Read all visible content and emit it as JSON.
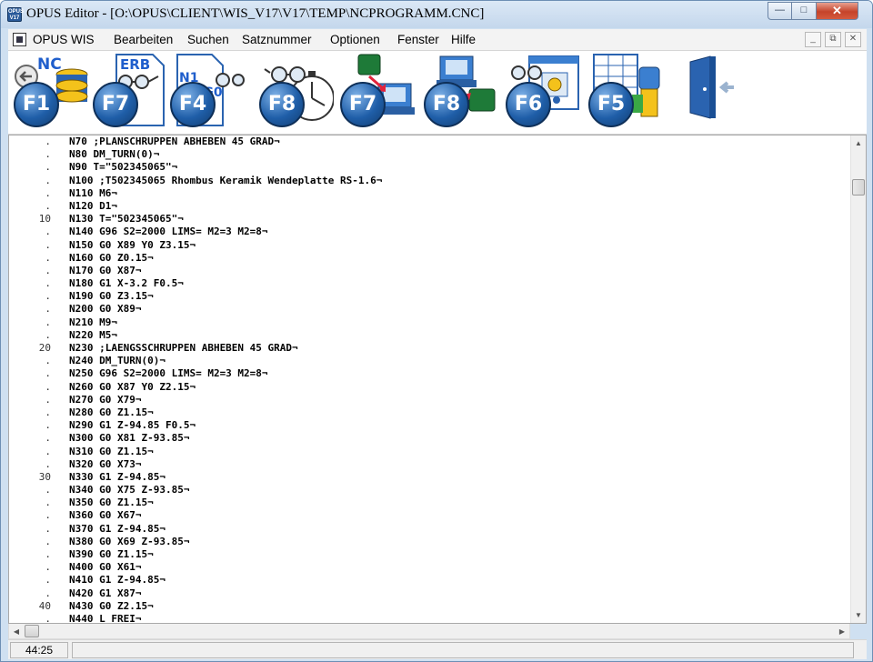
{
  "window": {
    "title": "OPUS Editor - [O:\\OPUS\\CLIENT\\WIS_V17\\V17\\TEMP\\NCPROGRAMM.CNC]",
    "app_icon_text": "OPUS V17"
  },
  "menu": {
    "items": [
      "OPUS WIS",
      "Bearbeiten",
      "Suchen",
      "Satznummer",
      "Optionen",
      "Fenster",
      "Hilfe"
    ]
  },
  "toolbar": {
    "buttons": [
      {
        "key": "F1",
        "caption": "NC",
        "icon": "nc-database-back-icon"
      },
      {
        "key": "F7",
        "caption": "ERB",
        "icon": "erb-document-glasses-icon"
      },
      {
        "key": "F4",
        "caption": "N1 N2 G0",
        "icon": "nc-blocks-document-icon"
      },
      {
        "key": "F8",
        "caption": "",
        "icon": "glasses-stopwatch-icon"
      },
      {
        "key": "F7",
        "caption": "",
        "icon": "transfer-machine-to-pc-icon"
      },
      {
        "key": "F8",
        "caption": "",
        "icon": "transfer-pc-to-machine-icon"
      },
      {
        "key": "F6",
        "caption": "",
        "icon": "glasses-settings-window-icon"
      },
      {
        "key": "F5",
        "caption": "",
        "icon": "table-tool-icon"
      },
      {
        "key": "",
        "caption": "",
        "icon": "exit-door-icon"
      }
    ]
  },
  "editor": {
    "line_numbers": [
      ".",
      ".",
      ".",
      ".",
      ".",
      ".",
      "10",
      ".",
      ".",
      ".",
      ".",
      ".",
      ".",
      ".",
      ".",
      ".",
      "20",
      ".",
      ".",
      ".",
      ".",
      ".",
      ".",
      ".",
      ".",
      ".",
      "30",
      ".",
      ".",
      ".",
      ".",
      ".",
      ".",
      ".",
      ".",
      ".",
      "40",
      "."
    ],
    "lines": [
      "N70 ;PLANSCHRUPPEN ABHEBEN 45 GRAD¬",
      "N80 DM_TURN(0)¬",
      "N90 T=\"502345065\"¬",
      "N100 ;T502345065 Rhombus Keramik Wendeplatte RS-1.6¬",
      "N110 M6¬",
      "N120 D1¬",
      "N130 T=\"502345065\"¬",
      "N140 G96 S2=2000 LIMS= M2=3 M2=8¬",
      "N150 G0 X89 Y0 Z3.15¬",
      "N160 G0 Z0.15¬",
      "N170 G0 X87¬",
      "N180 G1 X-3.2 F0.5¬",
      "N190 G0 Z3.15¬",
      "N200 G0 X89¬",
      "N210 M9¬",
      "N220 M5¬",
      "N230 ;LAENGSSCHRUPPEN ABHEBEN 45 GRAD¬",
      "N240 DM_TURN(0)¬",
      "N250 G96 S2=2000 LIMS= M2=3 M2=8¬",
      "N260 G0 X87 Y0 Z2.15¬",
      "N270 G0 X79¬",
      "N280 G0 Z1.15¬",
      "N290 G1 Z-94.85 F0.5¬",
      "N300 G0 X81 Z-93.85¬",
      "N310 G0 Z1.15¬",
      "N320 G0 X73¬",
      "N330 G1 Z-94.85¬",
      "N340 G0 X75 Z-93.85¬",
      "N350 G0 Z1.15¬",
      "N360 G0 X67¬",
      "N370 G1 Z-94.85¬",
      "N380 G0 X69 Z-93.85¬",
      "N390 G0 Z1.15¬",
      "N400 G0 X61¬",
      "N410 G1 Z-94.85¬",
      "N420 G1 X87¬",
      "N430 G0 Z2.15¬",
      "N440 L FREI¬"
    ]
  },
  "status": {
    "position": "44:25"
  },
  "colors": {
    "fkey_blue": "#1f5ea8",
    "close_red": "#c5432a"
  }
}
